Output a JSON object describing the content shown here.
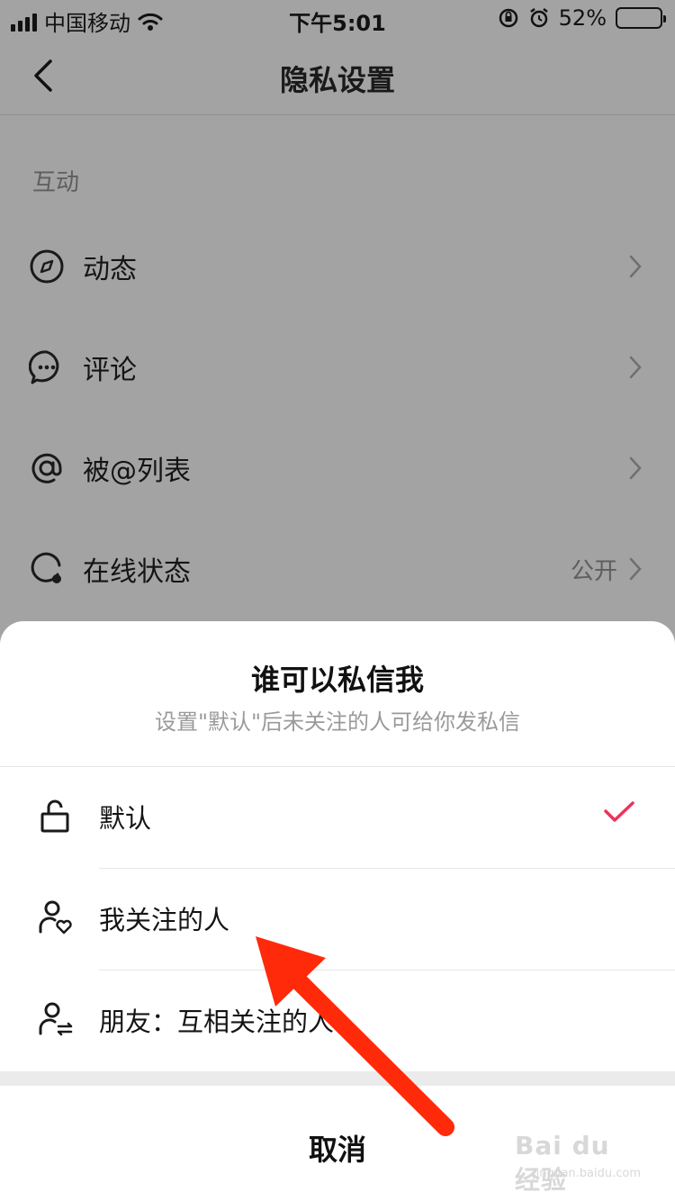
{
  "status_bar": {
    "carrier": "中国移动",
    "time": "下午5:01",
    "battery": "52%",
    "battery_level": 0.52,
    "icons": [
      "signal-icon",
      "wifi-icon",
      "orientation-lock-icon",
      "alarm-icon",
      "battery-icon"
    ]
  },
  "header": {
    "title": "隐私设置",
    "back_icon": "chevron-left-icon"
  },
  "section": {
    "label": "互动",
    "items": [
      {
        "label": "动态",
        "icon": "compass-icon",
        "value": ""
      },
      {
        "label": "评论",
        "icon": "comment-icon",
        "value": ""
      },
      {
        "label": "被@列表",
        "icon": "at-icon",
        "value": ""
      },
      {
        "label": "在线状态",
        "icon": "online-status-icon",
        "value": "公开"
      }
    ]
  },
  "sheet": {
    "title": "谁可以私信我",
    "subtitle": "设置\"默认\"后未关注的人可给你发私信",
    "options": [
      {
        "label": "默认",
        "icon": "unlock-icon",
        "selected": true
      },
      {
        "label": "我关注的人",
        "icon": "user-heart-icon",
        "selected": false
      },
      {
        "label": "朋友：互相关注的人",
        "icon": "user-mutual-icon",
        "selected": false
      }
    ],
    "cancel_label": "取消"
  },
  "annotation": {
    "arrow_color": "#ff2a0a"
  },
  "watermark": {
    "brand": "Bai du 经验",
    "url": "jingyan.baidu.com"
  },
  "colors": {
    "overlay_bg": "#a3a3a3",
    "check": "#f0325a",
    "sheet_bg": "#ffffff"
  }
}
